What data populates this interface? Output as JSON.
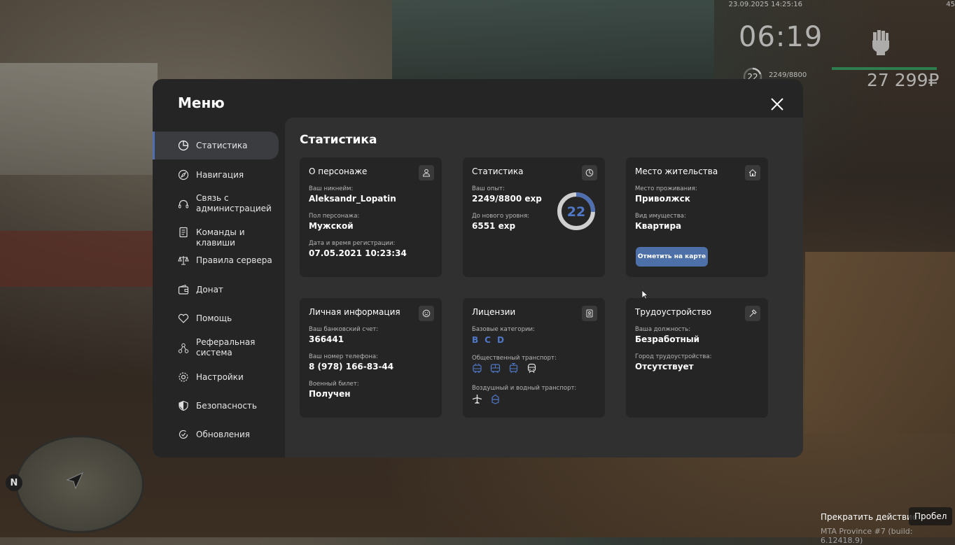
{
  "hud": {
    "datetime": "23.09.2025 14:25:16",
    "corner": "45",
    "time": "06:19",
    "level": "22",
    "exp": "2249/8800",
    "money": "27 299₽"
  },
  "minimap": {
    "north": "N"
  },
  "prompt": {
    "action": "Прекратить действие",
    "key": "Пробел"
  },
  "build": "MTA Province #7 (build: 6.12418.9)",
  "menu": {
    "title": "Меню",
    "sidebar": [
      {
        "label": "Статистика",
        "icon": "pie-chart-icon",
        "active": true
      },
      {
        "label": "Навигация",
        "icon": "compass-icon"
      },
      {
        "label": "Связь с администрацией",
        "icon": "headset-icon"
      },
      {
        "label": "Команды и клавиши",
        "icon": "document-icon"
      },
      {
        "label": "Правила сервера",
        "icon": "scales-icon"
      },
      {
        "label": "Донат",
        "icon": "wallet-icon"
      },
      {
        "label": "Помощь",
        "icon": "heart-icon"
      },
      {
        "label": "Реферальная система",
        "icon": "network-icon"
      },
      {
        "label": "Настройки",
        "icon": "gear-icon"
      },
      {
        "label": "Безопасность",
        "icon": "shield-icon"
      },
      {
        "label": "Обновления",
        "icon": "refresh-check-icon"
      }
    ],
    "content_title": "Статистика",
    "cards": {
      "character": {
        "title": "О персонаже",
        "nickname_label": "Ваш никнейм:",
        "nickname": "Aleksandr_Lopatin",
        "gender_label": "Пол персонажа:",
        "gender": "Мужской",
        "reg_label": "Дата и время регистрации:",
        "reg": "07.05.2021 10:23:34"
      },
      "stats": {
        "title": "Статистика",
        "exp_label": "Ваш опыт:",
        "exp": "2249/8800 exp",
        "next_label": "До нового уровня:",
        "next": "6551 exp",
        "level": "22",
        "progress": 0.2556
      },
      "residence": {
        "title": "Место жительства",
        "place_label": "Место проживания:",
        "place": "Приволжск",
        "property_label": "Вид имущества:",
        "property": "Квартира",
        "button": "Отметить на карте"
      },
      "personal": {
        "title": "Личная информация",
        "bank_label": "Ваш банковский счет:",
        "bank": "366441",
        "phone_label": "Ваш номер телефона:",
        "phone": "8 (978) 166-83-44",
        "military_label": "Военный билет:",
        "military": "Получен"
      },
      "licenses": {
        "title": "Лицензии",
        "base_label": "Базовые категории:",
        "categories": [
          "B",
          "C",
          "D"
        ],
        "public_label": "Общественный транспорт:",
        "air_label": "Воздушный и водный транспорт:"
      },
      "job": {
        "title": "Трудоустройство",
        "position_label": "Ваша должность:",
        "position": "Безработный",
        "city_label": "Город трудоустройства:",
        "city": "Отсутствует"
      }
    }
  }
}
